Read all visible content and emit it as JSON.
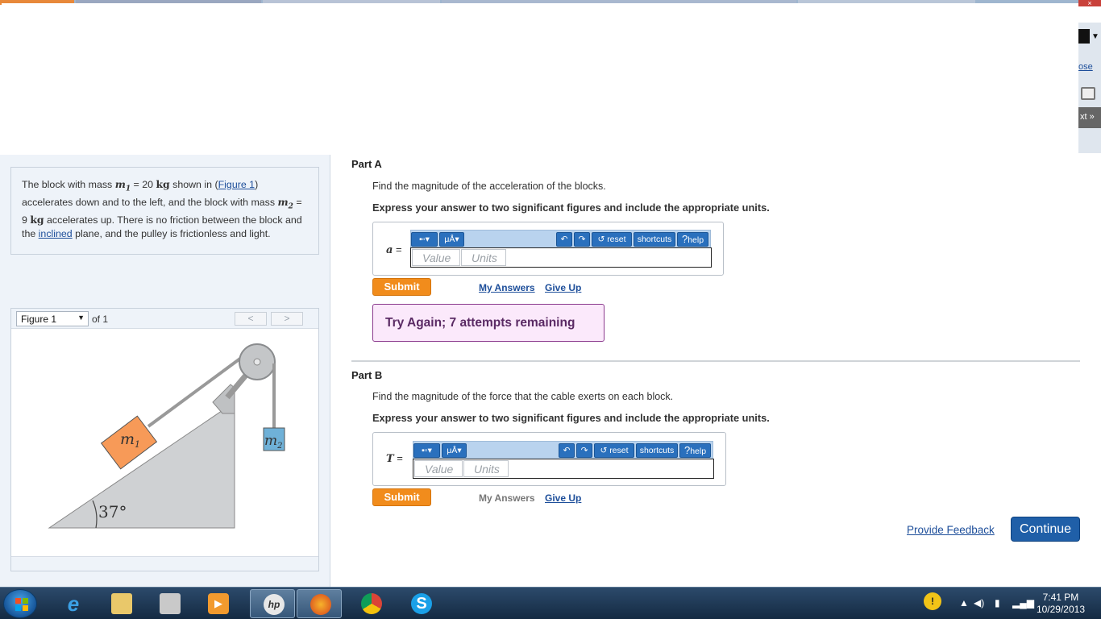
{
  "browser": {
    "close_label": "ose",
    "next_label": "xt »",
    "close_x": "×"
  },
  "problem": {
    "text_1": "The block with mass ",
    "m1": "m",
    "m1_sub": "1",
    "text_2": " = 20 ",
    "unit_kg": "kg",
    "text_3": " shown in (",
    "figure_link": "Figure 1",
    "text_4": ") accelerates down and to the left, and the block with mass ",
    "m2": "m",
    "m2_sub": "2",
    "text_5": " = 9 ",
    "text_6": " accelerates up. There is no friction between the block and the ",
    "inclined_link": "inclined",
    "text_7": " plane, and the pulley is frictionless and light."
  },
  "figure": {
    "select_value": "Figure 1",
    "of_label": "of 1",
    "prev": "<",
    "next": ">",
    "angle_label": "37°",
    "m1_label": "m",
    "m1_sub": "1",
    "m2_label": "m",
    "m2_sub": "2"
  },
  "partA": {
    "title": "Part A",
    "question": "Find the magnitude of the acceleration of the blocks.",
    "instruction": "Express your answer to two significant figures and include the appropriate units.",
    "var": "a",
    "eq": " =",
    "value_placeholder": "Value",
    "units_placeholder": "Units",
    "submit": "Submit",
    "my_answers": "My Answers",
    "give_up": "Give Up",
    "feedback": "Try Again; 7 attempts remaining"
  },
  "partB": {
    "title": "Part B",
    "question": "Find the magnitude of the force that the cable exerts on each block.",
    "instruction": "Express your answer to two significant figures and include the appropriate units.",
    "var": "T",
    "eq": " =",
    "value_placeholder": "Value",
    "units_placeholder": "Units",
    "submit": "Submit",
    "my_answers": "My Answers",
    "give_up": "Give Up"
  },
  "toolbar": {
    "template_label": "▪▫",
    "units_label": "μÅ",
    "reset": "reset",
    "shortcuts": "shortcuts",
    "help": "help",
    "help_q": "?"
  },
  "footer": {
    "provide_feedback": "Provide Feedback",
    "continue": "Continue"
  },
  "taskbar": {
    "time": "7:41 PM",
    "date": "10/29/2013",
    "apps": [
      "ie-icon",
      "explorer-icon",
      "printer-icon",
      "media-player-icon",
      "hp-icon",
      "firefox-icon",
      "chrome-icon",
      "skype-icon"
    ]
  }
}
